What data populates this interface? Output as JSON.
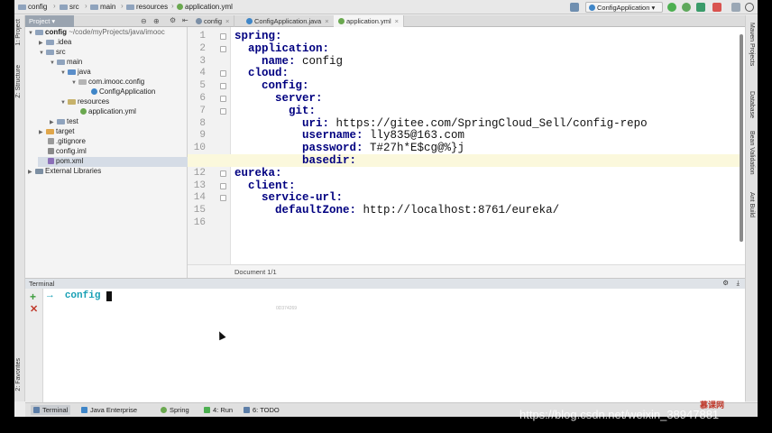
{
  "breadcrumb": [
    {
      "label": "config",
      "icon": "folder-icon"
    },
    {
      "label": "src",
      "icon": "folder-icon"
    },
    {
      "label": "main",
      "icon": "folder-icon"
    },
    {
      "label": "resources",
      "icon": "folder-icon"
    },
    {
      "label": "application.yml",
      "icon": "yml-file-icon"
    }
  ],
  "run_config": "ConfigApplication",
  "project_panel_label": "Project",
  "tabs": [
    {
      "label": "config",
      "active": false
    },
    {
      "label": "ConfigApplication.java",
      "active": false
    },
    {
      "label": "application.yml",
      "active": true
    }
  ],
  "left_stripe": {
    "project": "1: Project",
    "structure": "Z: Structure",
    "favorites": "2: Favorites"
  },
  "right_stripe": {
    "maven": "Maven Projects",
    "database": "Database",
    "bean": "Bean Validation",
    "ant": "Ant Build"
  },
  "tree": {
    "root_name": "config",
    "root_path": "~/code/myProjects/java/imooc",
    "items": [
      {
        "label": "idea",
        "prefix": "."
      },
      {
        "label": "src"
      },
      {
        "label": "main"
      },
      {
        "label": "java"
      },
      {
        "label": "com.imooc.config"
      },
      {
        "label": "ConfigApplication"
      },
      {
        "label": "resources"
      },
      {
        "label": "application.yml"
      },
      {
        "label": "test"
      },
      {
        "label": "target"
      },
      {
        "label": ".gitignore"
      },
      {
        "label": "config.iml"
      },
      {
        "label": "pom.xml"
      },
      {
        "label": "External Libraries"
      }
    ]
  },
  "editor": {
    "line_numbers": [
      "1",
      "2",
      "3",
      "4",
      "5",
      "6",
      "7",
      "8",
      "9",
      "10",
      "11",
      "12",
      "13",
      "14",
      "15",
      "16"
    ],
    "lines": [
      {
        "key": "spring:",
        "value": ""
      },
      {
        "key": "  application:",
        "value": ""
      },
      {
        "key": "    name:",
        "value": " config"
      },
      {
        "key": "  cloud:",
        "value": ""
      },
      {
        "key": "    config:",
        "value": ""
      },
      {
        "key": "      server:",
        "value": ""
      },
      {
        "key": "        git:",
        "value": ""
      },
      {
        "key": "          uri:",
        "value": " https://gitee.com/SpringCloud_Sell/config-repo"
      },
      {
        "key": "          username:",
        "value": " lly835@163.com"
      },
      {
        "key": "          password:",
        "value": " T#27h*E$cg@%}j"
      },
      {
        "key": "          basedir:",
        "value": ""
      },
      {
        "key": "eureka:",
        "value": ""
      },
      {
        "key": "  client:",
        "value": ""
      },
      {
        "key": "    service-url:",
        "value": ""
      },
      {
        "key": "      defaultZone:",
        "value": " http://localhost:8761/eureka/"
      },
      {
        "key": "",
        "value": ""
      }
    ],
    "current_line": 11,
    "status": "Document 1/1"
  },
  "terminal": {
    "header": "Terminal",
    "prompt_arrow": "→",
    "prompt_dir": "config",
    "id_text": "0D374269"
  },
  "bottom_tabs": [
    {
      "label": "Terminal",
      "active": true,
      "color": "#5d7ea8"
    },
    {
      "label": "Java Enterprise",
      "active": false,
      "color": "#3f86c8"
    },
    {
      "label": "Spring",
      "active": false,
      "color": "#6aa84f"
    },
    {
      "label": "4: Run",
      "active": false,
      "color": "#4caf50"
    },
    {
      "label": "6: TODO",
      "active": false,
      "color": "#5d7ea8"
    }
  ],
  "watermark": "https://blog.csdn.net/weixin_38947881",
  "logo_text": "慕课网",
  "colors": {
    "accent": "#18a0b5",
    "key": "#000080",
    "current_line": "#fbf8dc"
  }
}
